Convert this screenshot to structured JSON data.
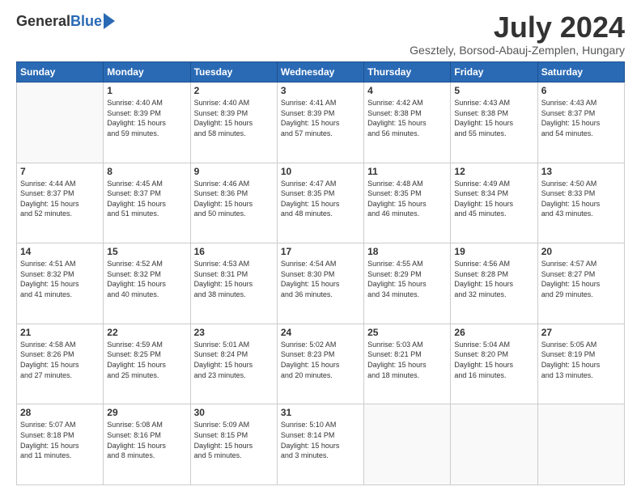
{
  "header": {
    "logo_general": "General",
    "logo_blue": "Blue",
    "month_title": "July 2024",
    "location": "Gesztely, Borsod-Abauj-Zemplen, Hungary"
  },
  "days_of_week": [
    "Sunday",
    "Monday",
    "Tuesday",
    "Wednesday",
    "Thursday",
    "Friday",
    "Saturday"
  ],
  "weeks": [
    [
      {
        "day": "",
        "info": ""
      },
      {
        "day": "1",
        "info": "Sunrise: 4:40 AM\nSunset: 8:39 PM\nDaylight: 15 hours\nand 59 minutes."
      },
      {
        "day": "2",
        "info": "Sunrise: 4:40 AM\nSunset: 8:39 PM\nDaylight: 15 hours\nand 58 minutes."
      },
      {
        "day": "3",
        "info": "Sunrise: 4:41 AM\nSunset: 8:39 PM\nDaylight: 15 hours\nand 57 minutes."
      },
      {
        "day": "4",
        "info": "Sunrise: 4:42 AM\nSunset: 8:38 PM\nDaylight: 15 hours\nand 56 minutes."
      },
      {
        "day": "5",
        "info": "Sunrise: 4:43 AM\nSunset: 8:38 PM\nDaylight: 15 hours\nand 55 minutes."
      },
      {
        "day": "6",
        "info": "Sunrise: 4:43 AM\nSunset: 8:37 PM\nDaylight: 15 hours\nand 54 minutes."
      }
    ],
    [
      {
        "day": "7",
        "info": "Sunrise: 4:44 AM\nSunset: 8:37 PM\nDaylight: 15 hours\nand 52 minutes."
      },
      {
        "day": "8",
        "info": "Sunrise: 4:45 AM\nSunset: 8:37 PM\nDaylight: 15 hours\nand 51 minutes."
      },
      {
        "day": "9",
        "info": "Sunrise: 4:46 AM\nSunset: 8:36 PM\nDaylight: 15 hours\nand 50 minutes."
      },
      {
        "day": "10",
        "info": "Sunrise: 4:47 AM\nSunset: 8:35 PM\nDaylight: 15 hours\nand 48 minutes."
      },
      {
        "day": "11",
        "info": "Sunrise: 4:48 AM\nSunset: 8:35 PM\nDaylight: 15 hours\nand 46 minutes."
      },
      {
        "day": "12",
        "info": "Sunrise: 4:49 AM\nSunset: 8:34 PM\nDaylight: 15 hours\nand 45 minutes."
      },
      {
        "day": "13",
        "info": "Sunrise: 4:50 AM\nSunset: 8:33 PM\nDaylight: 15 hours\nand 43 minutes."
      }
    ],
    [
      {
        "day": "14",
        "info": "Sunrise: 4:51 AM\nSunset: 8:32 PM\nDaylight: 15 hours\nand 41 minutes."
      },
      {
        "day": "15",
        "info": "Sunrise: 4:52 AM\nSunset: 8:32 PM\nDaylight: 15 hours\nand 40 minutes."
      },
      {
        "day": "16",
        "info": "Sunrise: 4:53 AM\nSunset: 8:31 PM\nDaylight: 15 hours\nand 38 minutes."
      },
      {
        "day": "17",
        "info": "Sunrise: 4:54 AM\nSunset: 8:30 PM\nDaylight: 15 hours\nand 36 minutes."
      },
      {
        "day": "18",
        "info": "Sunrise: 4:55 AM\nSunset: 8:29 PM\nDaylight: 15 hours\nand 34 minutes."
      },
      {
        "day": "19",
        "info": "Sunrise: 4:56 AM\nSunset: 8:28 PM\nDaylight: 15 hours\nand 32 minutes."
      },
      {
        "day": "20",
        "info": "Sunrise: 4:57 AM\nSunset: 8:27 PM\nDaylight: 15 hours\nand 29 minutes."
      }
    ],
    [
      {
        "day": "21",
        "info": "Sunrise: 4:58 AM\nSunset: 8:26 PM\nDaylight: 15 hours\nand 27 minutes."
      },
      {
        "day": "22",
        "info": "Sunrise: 4:59 AM\nSunset: 8:25 PM\nDaylight: 15 hours\nand 25 minutes."
      },
      {
        "day": "23",
        "info": "Sunrise: 5:01 AM\nSunset: 8:24 PM\nDaylight: 15 hours\nand 23 minutes."
      },
      {
        "day": "24",
        "info": "Sunrise: 5:02 AM\nSunset: 8:23 PM\nDaylight: 15 hours\nand 20 minutes."
      },
      {
        "day": "25",
        "info": "Sunrise: 5:03 AM\nSunset: 8:21 PM\nDaylight: 15 hours\nand 18 minutes."
      },
      {
        "day": "26",
        "info": "Sunrise: 5:04 AM\nSunset: 8:20 PM\nDaylight: 15 hours\nand 16 minutes."
      },
      {
        "day": "27",
        "info": "Sunrise: 5:05 AM\nSunset: 8:19 PM\nDaylight: 15 hours\nand 13 minutes."
      }
    ],
    [
      {
        "day": "28",
        "info": "Sunrise: 5:07 AM\nSunset: 8:18 PM\nDaylight: 15 hours\nand 11 minutes."
      },
      {
        "day": "29",
        "info": "Sunrise: 5:08 AM\nSunset: 8:16 PM\nDaylight: 15 hours\nand 8 minutes."
      },
      {
        "day": "30",
        "info": "Sunrise: 5:09 AM\nSunset: 8:15 PM\nDaylight: 15 hours\nand 5 minutes."
      },
      {
        "day": "31",
        "info": "Sunrise: 5:10 AM\nSunset: 8:14 PM\nDaylight: 15 hours\nand 3 minutes."
      },
      {
        "day": "",
        "info": ""
      },
      {
        "day": "",
        "info": ""
      },
      {
        "day": "",
        "info": ""
      }
    ]
  ]
}
